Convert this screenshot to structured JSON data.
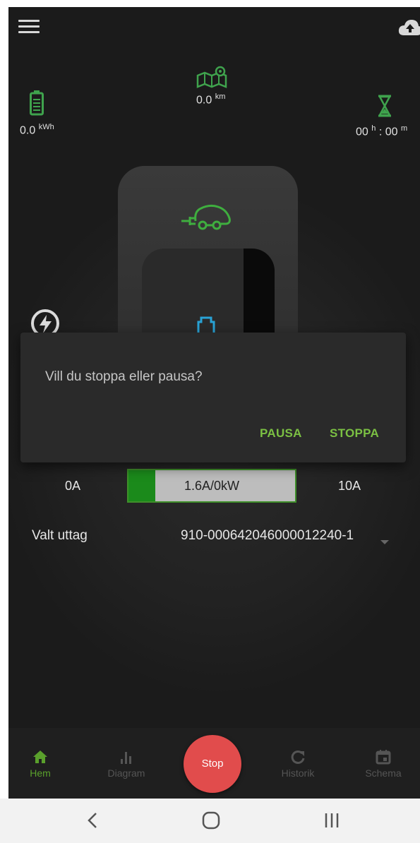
{
  "stats": {
    "energy": {
      "value": "0.0",
      "unit": "kWh",
      "icon": "battery-icon"
    },
    "distance": {
      "value": "0.0",
      "unit": "km",
      "icon": "map-pin-icon"
    },
    "time": {
      "hours": "00",
      "h_unit": "h",
      "sep": ":",
      "minutes": "00",
      "m_unit": "m",
      "icon": "hourglass-icon"
    }
  },
  "dialog": {
    "message": "Vill du stoppa eller pausa?",
    "pause_label": "PAUSA",
    "stop_label": "STOPPA"
  },
  "current": {
    "min_label": "0A",
    "max_label": "10A",
    "display": "1.6A/0kW",
    "level_fraction": 0.16
  },
  "outlet": {
    "label": "Valt uttag",
    "value": "910-000642046000012240-1"
  },
  "nav": {
    "items": [
      {
        "label": "Hem",
        "icon": "home-icon"
      },
      {
        "label": "Diagram",
        "icon": "bar-chart-icon"
      },
      {
        "label": "Historik",
        "icon": "refresh-icon"
      },
      {
        "label": "Schema",
        "icon": "calendar-icon"
      }
    ],
    "stop_label": "Stop"
  },
  "colors": {
    "accent_green": "#7bc043",
    "stop_red": "#e14c4c",
    "plug_cyan": "#29a3d6"
  }
}
